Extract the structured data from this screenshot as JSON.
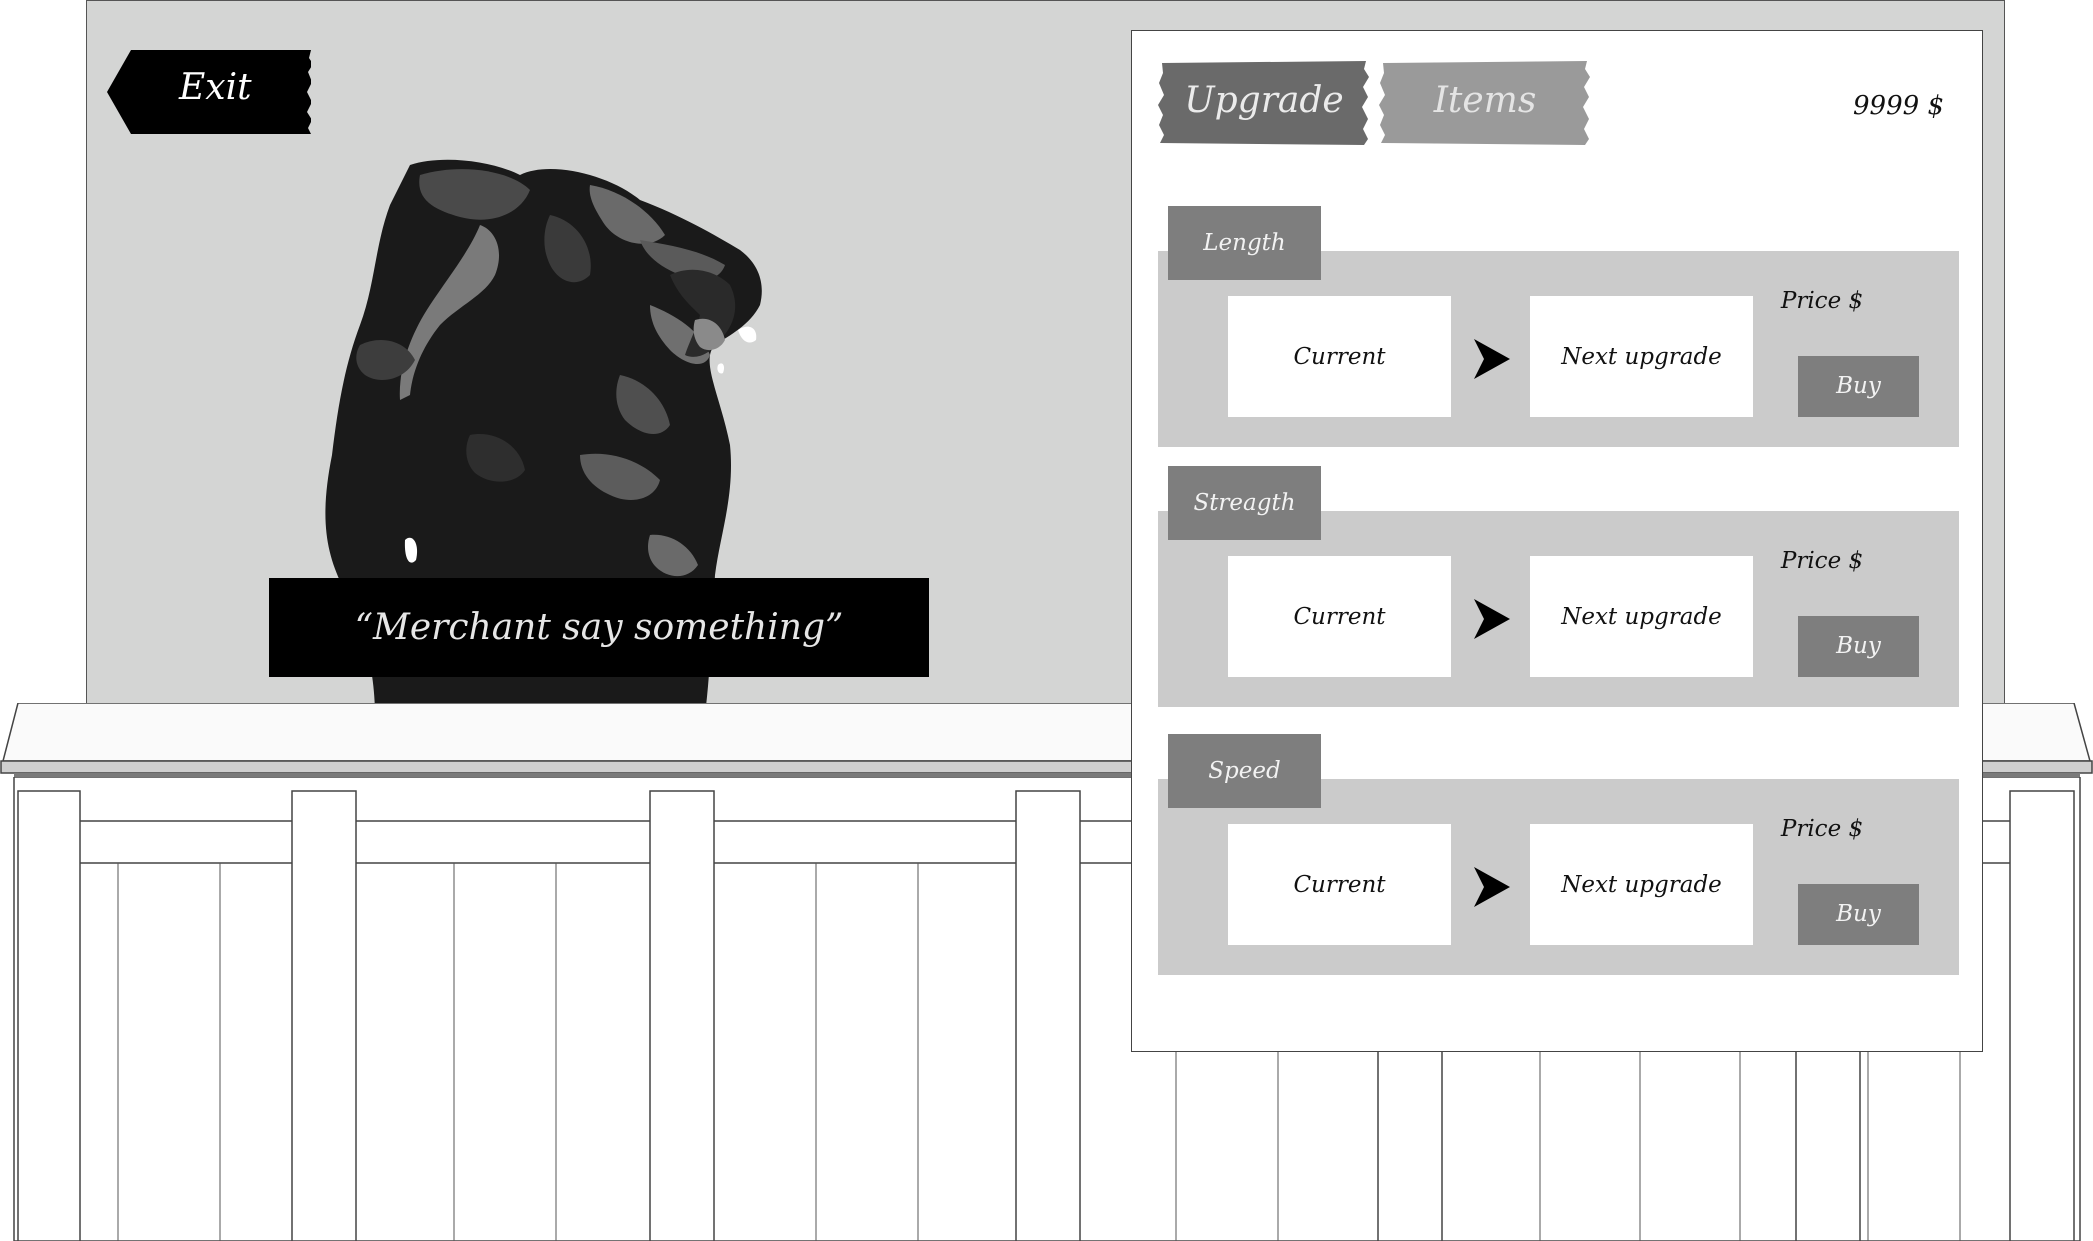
{
  "exit": {
    "label": "Exit"
  },
  "merchant": {
    "quote": "“Merchant say something”"
  },
  "shop": {
    "tabs": [
      {
        "label": "Upgrade",
        "active": true
      },
      {
        "label": "Items",
        "active": false
      }
    ],
    "money": "9999 $",
    "upgrades": [
      {
        "name": "Length",
        "current": "Current",
        "next": "Next upgrade",
        "price": "Price $",
        "buy": "Buy"
      },
      {
        "name": "Streagth",
        "current": "Current",
        "next": "Next upgrade",
        "price": "Price $",
        "buy": "Buy"
      },
      {
        "name": "Speed",
        "current": "Current",
        "next": "Next upgrade",
        "price": "Price $",
        "buy": "Buy"
      }
    ]
  },
  "colors": {
    "backdrop": "#d4d5d4",
    "tab_active": "#6a6a6a",
    "tab_inactive": "#9a9a9a",
    "section_label": "#7e7e7e",
    "section_bg": "#cbcbcb",
    "buy_button": "#7e7e7e"
  }
}
